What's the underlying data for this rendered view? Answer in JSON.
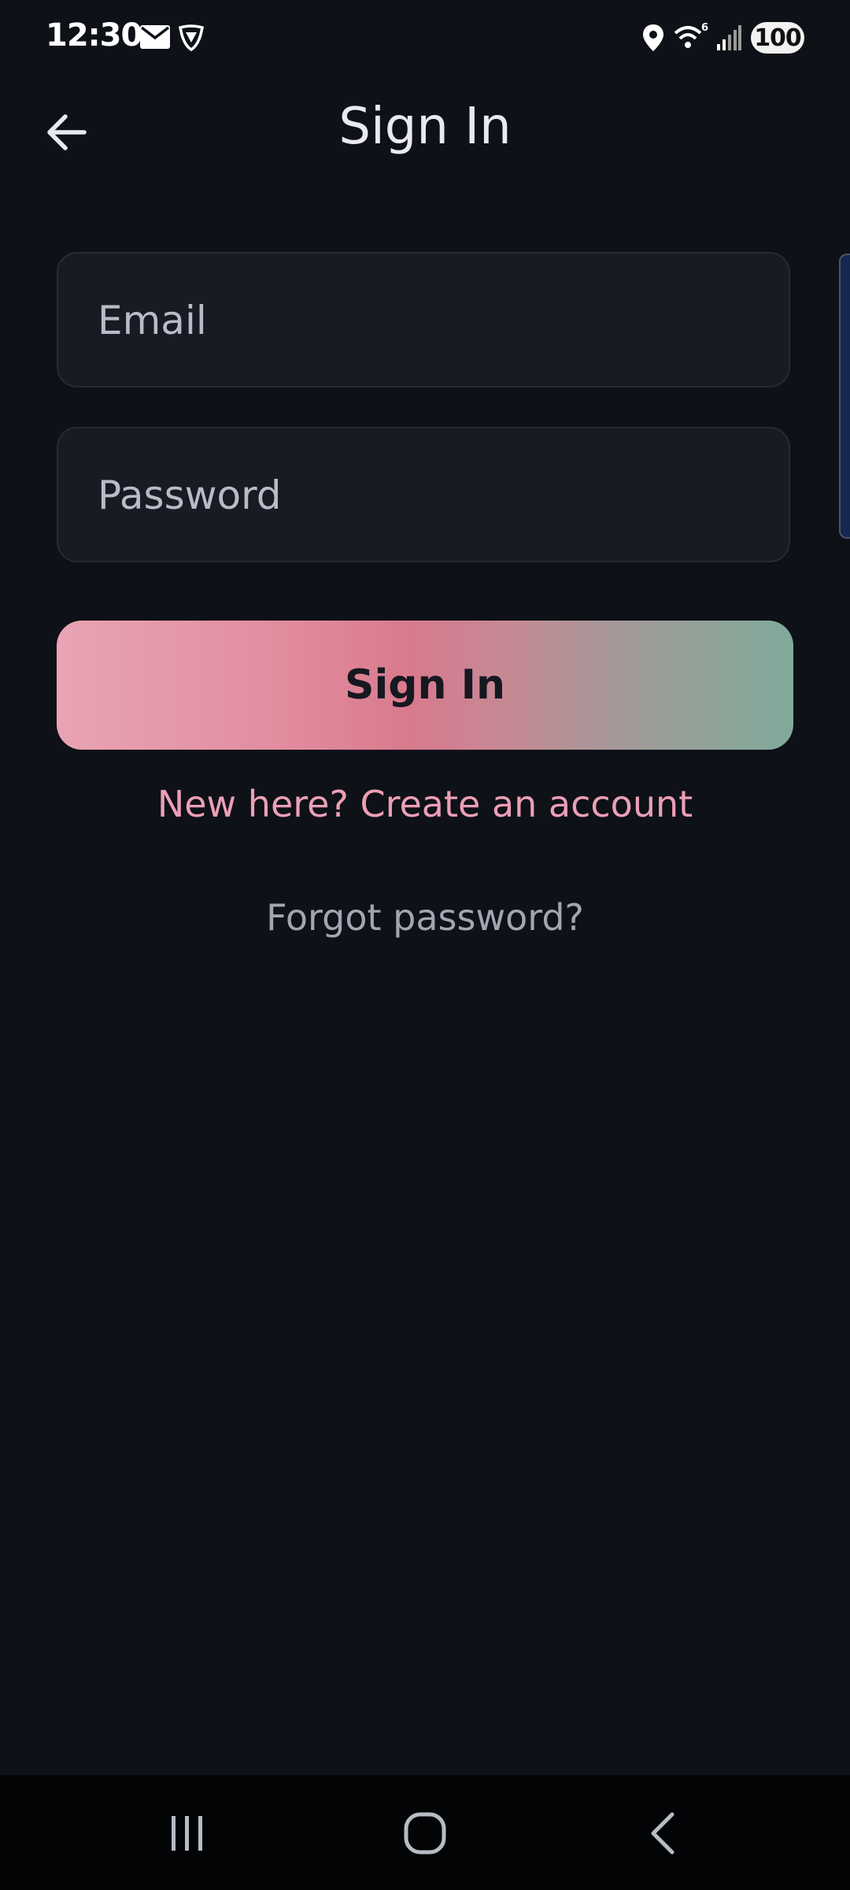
{
  "status_bar": {
    "time": "12:30",
    "battery": "100",
    "icons": [
      "mail-icon",
      "shield-app-icon",
      "location-icon",
      "wifi-icon",
      "signal-icon"
    ]
  },
  "header": {
    "title": "Sign In",
    "back_icon": "arrow-left-icon"
  },
  "form": {
    "email_placeholder": "Email",
    "email_value": "",
    "password_placeholder": "Password",
    "password_value": "",
    "submit_label": "Sign In"
  },
  "links": {
    "create_account": "New here? Create an account",
    "forgot_password": "Forgot password?"
  },
  "nav_bar": {
    "icons": [
      "recents-icon",
      "home-icon",
      "back-icon"
    ]
  },
  "colors": {
    "background": "#0e1118",
    "field_bg": "#171b24",
    "link_pink": "#ec9fb6",
    "muted_text": "#a2a6b2",
    "gradient_start": "#e8a4b4",
    "gradient_mid": "#d97a8e",
    "gradient_end": "#7faa99"
  }
}
